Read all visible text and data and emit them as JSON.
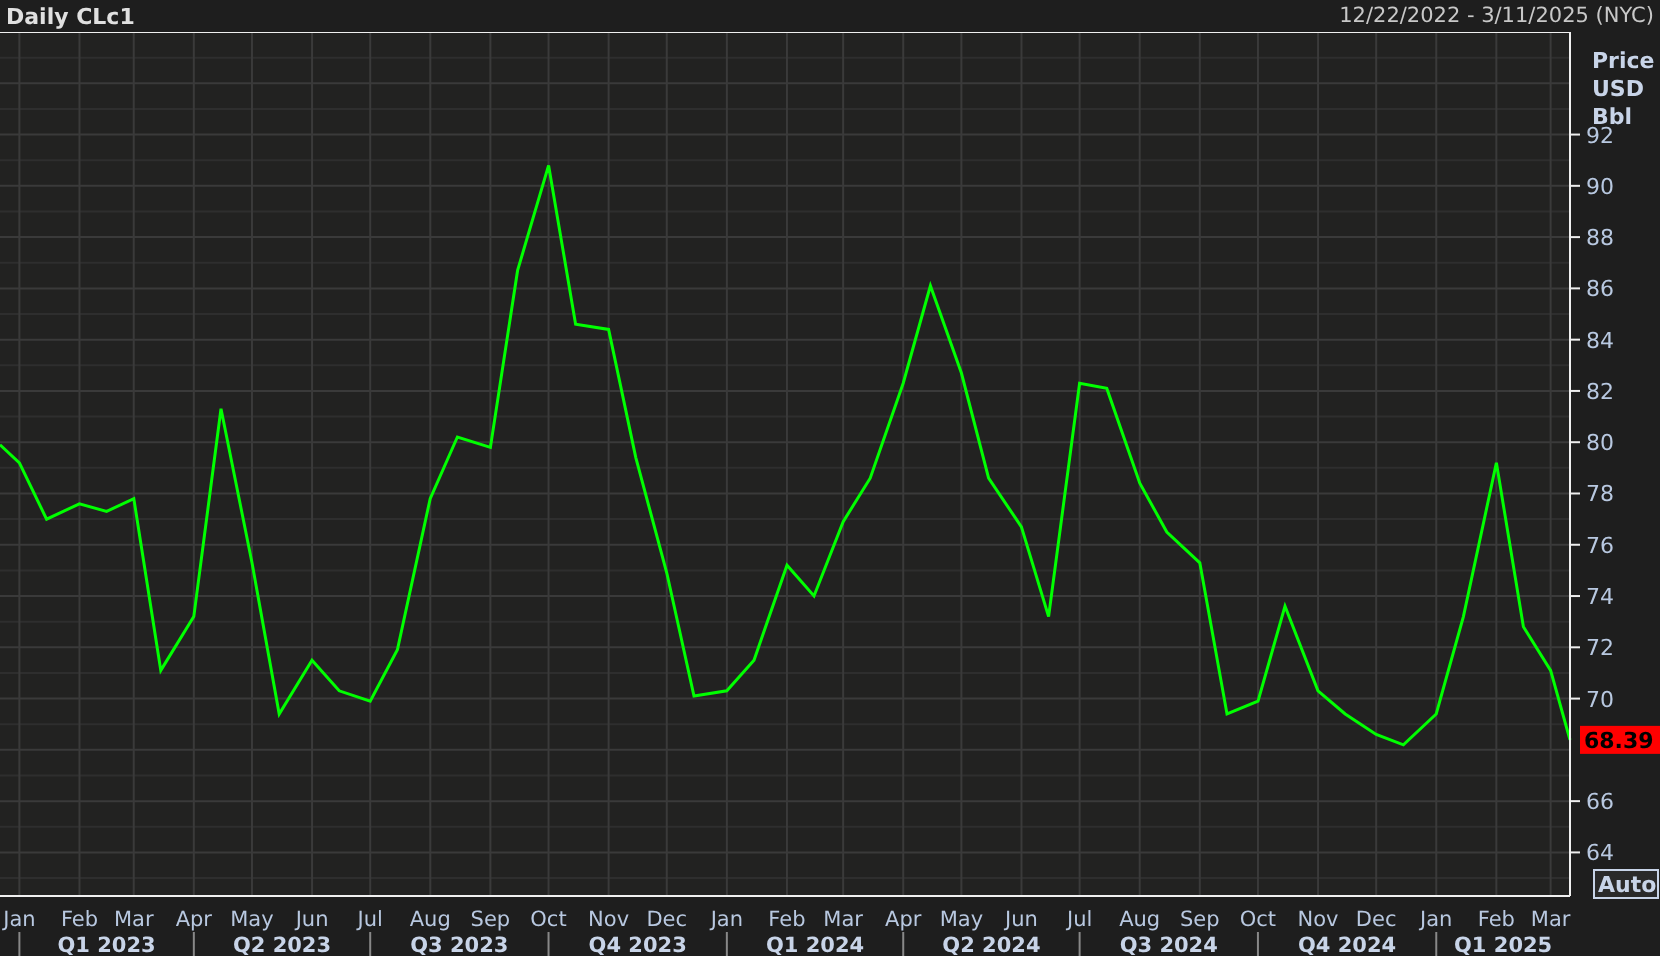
{
  "header": {
    "range": "12/22/2022 - 3/11/2025 (NYC)"
  },
  "chart": {
    "last_price": "68.39",
    "scale_button": "Auto",
    "quarters": [
      "Q1 2023",
      "Q2 2023",
      "Q3 2023",
      "Q4 2023",
      "Q1 2024",
      "Q2 2024",
      "Q3 2024",
      "Q4 2024",
      "Q1 2025"
    ],
    "chart_data": {
      "type": "line",
      "title": "Daily CLc1",
      "ylabel": "Price USD Bbl",
      "xlim": [
        "2022-12-22",
        "2025-03-11"
      ],
      "ylim": [
        62.3,
        96
      ],
      "grid": true,
      "yticks": [
        64,
        66,
        70,
        72,
        74,
        76,
        78,
        80,
        82,
        84,
        86,
        88,
        90,
        92
      ],
      "xticks": [
        {
          "value": "2023-01-01",
          "label": "Jan"
        },
        {
          "value": "2023-02-01",
          "label": "Feb"
        },
        {
          "value": "2023-03-01",
          "label": "Mar"
        },
        {
          "value": "2023-04-01",
          "label": "Apr"
        },
        {
          "value": "2023-05-01",
          "label": "May"
        },
        {
          "value": "2023-06-01",
          "label": "Jun"
        },
        {
          "value": "2023-07-01",
          "label": "Jul"
        },
        {
          "value": "2023-08-01",
          "label": "Aug"
        },
        {
          "value": "2023-09-01",
          "label": "Sep"
        },
        {
          "value": "2023-10-01",
          "label": "Oct"
        },
        {
          "value": "2023-11-01",
          "label": "Nov"
        },
        {
          "value": "2023-12-01",
          "label": "Dec"
        },
        {
          "value": "2024-01-01",
          "label": "Jan"
        },
        {
          "value": "2024-02-01",
          "label": "Feb"
        },
        {
          "value": "2024-03-01",
          "label": "Mar"
        },
        {
          "value": "2024-04-01",
          "label": "Apr"
        },
        {
          "value": "2024-05-01",
          "label": "May"
        },
        {
          "value": "2024-06-01",
          "label": "Jun"
        },
        {
          "value": "2024-07-01",
          "label": "Jul"
        },
        {
          "value": "2024-08-01",
          "label": "Aug"
        },
        {
          "value": "2024-09-01",
          "label": "Sep"
        },
        {
          "value": "2024-10-01",
          "label": "Oct"
        },
        {
          "value": "2024-11-01",
          "label": "Nov"
        },
        {
          "value": "2024-12-01",
          "label": "Dec"
        },
        {
          "value": "2025-01-01",
          "label": "Jan"
        },
        {
          "value": "2025-02-01",
          "label": "Feb"
        },
        {
          "value": "2025-03-01",
          "label": "Mar"
        }
      ],
      "x": [
        "2022-12-22",
        "2023-01-01",
        "2023-01-15",
        "2023-02-01",
        "2023-02-15",
        "2023-03-01",
        "2023-03-15",
        "2023-04-01",
        "2023-04-15",
        "2023-05-01",
        "2023-05-15",
        "2023-06-01",
        "2023-06-15",
        "2023-07-01",
        "2023-07-15",
        "2023-08-01",
        "2023-08-15",
        "2023-09-01",
        "2023-09-15",
        "2023-10-01",
        "2023-10-15",
        "2023-11-01",
        "2023-11-15",
        "2023-12-01",
        "2023-12-15",
        "2024-01-01",
        "2024-01-15",
        "2024-02-01",
        "2024-02-15",
        "2024-03-01",
        "2024-03-15",
        "2024-04-01",
        "2024-04-15",
        "2024-05-01",
        "2024-05-15",
        "2024-06-01",
        "2024-06-15",
        "2024-07-01",
        "2024-07-15",
        "2024-08-01",
        "2024-08-15",
        "2024-09-01",
        "2024-09-15",
        "2024-10-01",
        "2024-10-15",
        "2024-11-01",
        "2024-11-15",
        "2024-12-01",
        "2024-12-15",
        "2025-01-01",
        "2025-01-15",
        "2025-02-01",
        "2025-02-15",
        "2025-03-01",
        "2025-03-11"
      ],
      "series": [
        {
          "color": "#00ff00",
          "values": [
            79.9,
            79.2,
            77.0,
            77.6,
            77.3,
            77.8,
            71.1,
            73.2,
            81.3,
            75.3,
            69.4,
            71.5,
            70.3,
            69.9,
            71.9,
            77.8,
            80.2,
            79.8,
            86.7,
            90.8,
            84.6,
            84.4,
            79.4,
            74.9,
            70.1,
            70.3,
            71.5,
            75.2,
            74.0,
            76.9,
            78.6,
            82.3,
            86.1,
            82.7,
            78.6,
            76.7,
            73.2,
            82.3,
            82.1,
            78.4,
            76.5,
            75.3,
            69.4,
            69.9,
            73.6,
            70.3,
            69.4,
            68.6,
            68.2,
            69.4,
            73.2,
            79.2,
            72.8,
            71.1,
            68.39
          ]
        }
      ]
    }
  }
}
